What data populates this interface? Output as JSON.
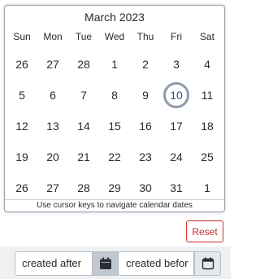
{
  "calendar": {
    "month_title": "March 2023",
    "weekdays": [
      "Sun",
      "Mon",
      "Tue",
      "Wed",
      "Thu",
      "Fri",
      "Sat"
    ],
    "weeks": [
      [
        "26",
        "27",
        "28",
        "1",
        "2",
        "3",
        "4"
      ],
      [
        "5",
        "6",
        "7",
        "8",
        "9",
        "10",
        "11"
      ],
      [
        "12",
        "13",
        "14",
        "15",
        "16",
        "17",
        "18"
      ],
      [
        "19",
        "20",
        "21",
        "22",
        "23",
        "24",
        "25"
      ],
      [
        "26",
        "27",
        "28",
        "29",
        "30",
        "31",
        "1"
      ]
    ],
    "selected_day": "10",
    "hint": "Use cursor keys to navigate calendar dates"
  },
  "reset_label": "Reset",
  "filters": {
    "after_value": "created after",
    "before_value": "created befor"
  },
  "icons": {
    "calendar": "calendar-icon"
  },
  "colors": {
    "selected_ring": "#8e9bab",
    "reset": "#c9302c"
  }
}
